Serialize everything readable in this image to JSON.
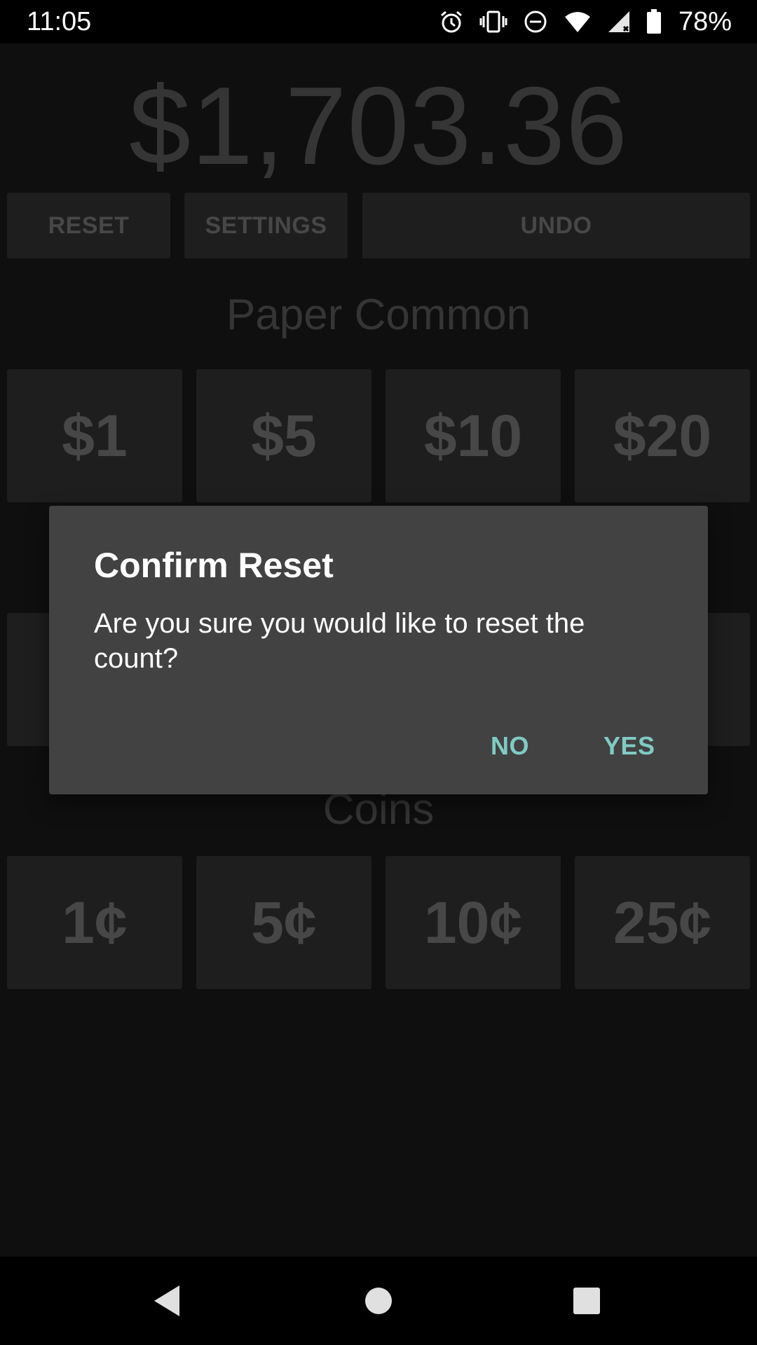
{
  "status_bar": {
    "time": "11:05",
    "battery": "78%",
    "icons": [
      "alarm-icon",
      "vibrate-icon",
      "do-not-disturb-icon",
      "wifi-icon",
      "cell-signal-icon",
      "battery-icon"
    ]
  },
  "app": {
    "total": "$1,703.36",
    "toolbar": {
      "reset_label": "RESET",
      "settings_label": "SETTINGS",
      "undo_label": "UNDO"
    },
    "paper_common": {
      "title": "Paper Common",
      "denominations": [
        "$1",
        "$5",
        "$10",
        "$20"
      ]
    },
    "coins": {
      "title": "Coins",
      "denominations": [
        "1¢",
        "5¢",
        "10¢",
        "25¢"
      ]
    }
  },
  "dialog": {
    "title": "Confirm Reset",
    "message": "Are you sure you would like to reset the count?",
    "no_label": "NO",
    "yes_label": "YES"
  },
  "colors": {
    "app_background": "#1f1f1f",
    "button": "#3c3c3c",
    "dialog": "#424242",
    "accent": "#80cbc4"
  },
  "nav_bar": {
    "icons": [
      "back-icon",
      "home-icon",
      "recents-icon"
    ]
  }
}
